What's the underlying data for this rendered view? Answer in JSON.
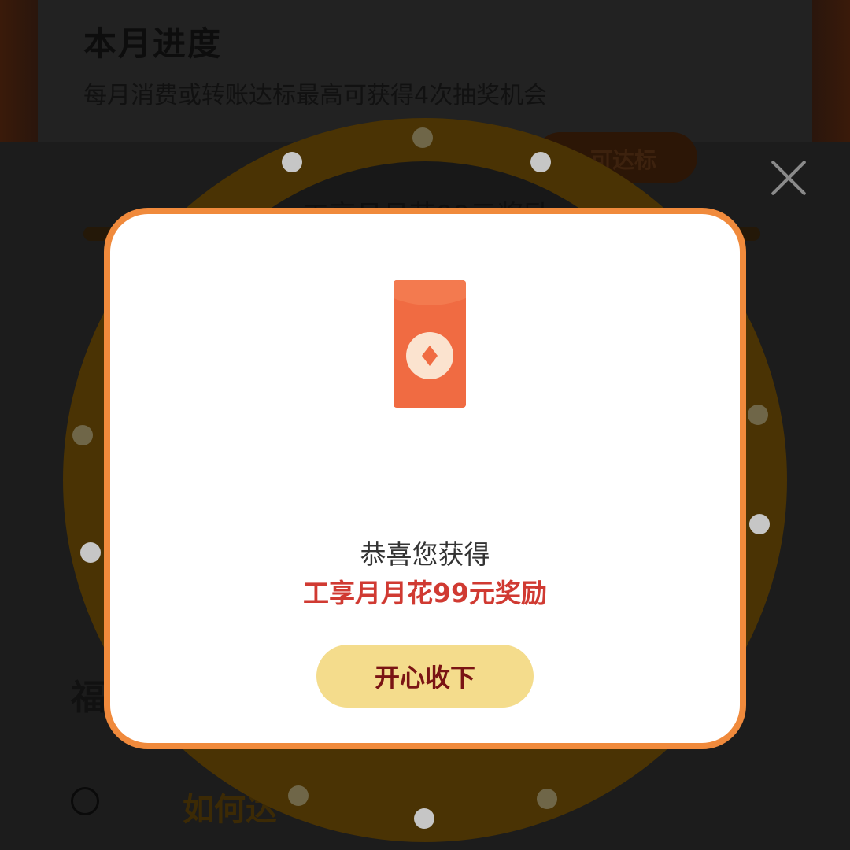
{
  "background": {
    "page_title": "本月进度",
    "subtitle": "每月消费或转账达标最高可获得4次抽奖机会",
    "pill_label": "可达标",
    "section_char": "福",
    "howto_label": "如何达"
  },
  "wheel": {
    "prize_text": "工享月月花99元奖励"
  },
  "modal": {
    "congrats_text": "恭喜您获得",
    "prize_text": "工享月月花99元奖励",
    "accept_button_label": "开心收下"
  },
  "icons": {
    "close": "close-icon",
    "envelope": "red-envelope-icon"
  },
  "colors": {
    "modal_border": "#f08a3c",
    "prize_text": "#d03a32",
    "button_bg": "#f4dc8c",
    "button_text": "#7a1414",
    "envelope": "#f06b42",
    "wheel_rim": "#4a3304"
  }
}
